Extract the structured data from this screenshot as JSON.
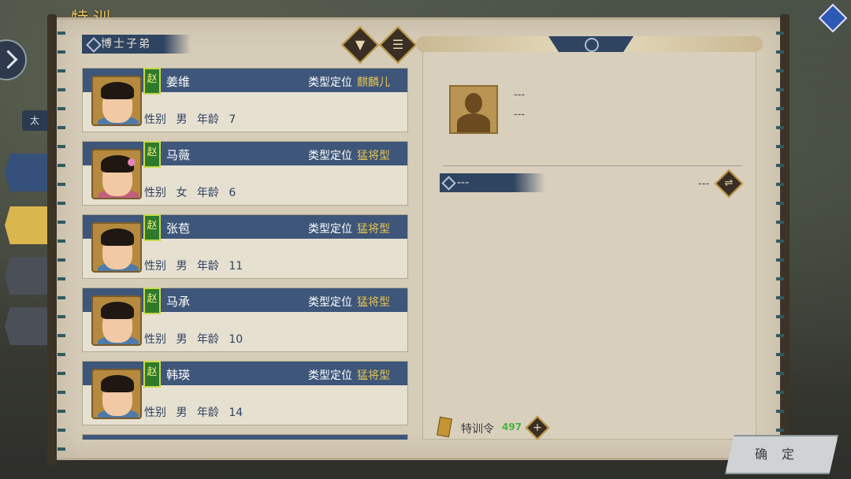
{
  "title": "特训",
  "side": {
    "small_tab": "太"
  },
  "category": "博士子弟",
  "type_label": "类型定位",
  "gender_label": "性别",
  "age_label": "年龄",
  "characters": [
    {
      "nation": "赵",
      "name": "姜维",
      "type": "麒麟儿",
      "gender": "男",
      "age": "7"
    },
    {
      "nation": "赵",
      "name": "马薇",
      "type": "猛将型",
      "gender": "女",
      "age": "6"
    },
    {
      "nation": "赵",
      "name": "张苞",
      "type": "猛将型",
      "gender": "男",
      "age": "11"
    },
    {
      "nation": "赵",
      "name": "马承",
      "type": "猛将型",
      "gender": "男",
      "age": "10"
    },
    {
      "nation": "赵",
      "name": "韩瑛",
      "type": "猛将型",
      "gender": "男",
      "age": "14"
    }
  ],
  "detail": {
    "line1": "---",
    "line2": "---",
    "skill_name": "---",
    "skill_value": "---"
  },
  "token": {
    "label": "特训令",
    "count": "497"
  },
  "confirm_label": "确定",
  "colors": {
    "card_header": "#3d5679",
    "type_highlight": "#e8c34f",
    "nation_badge": "#2e7a2a",
    "accent_gold": "#c39b47"
  }
}
